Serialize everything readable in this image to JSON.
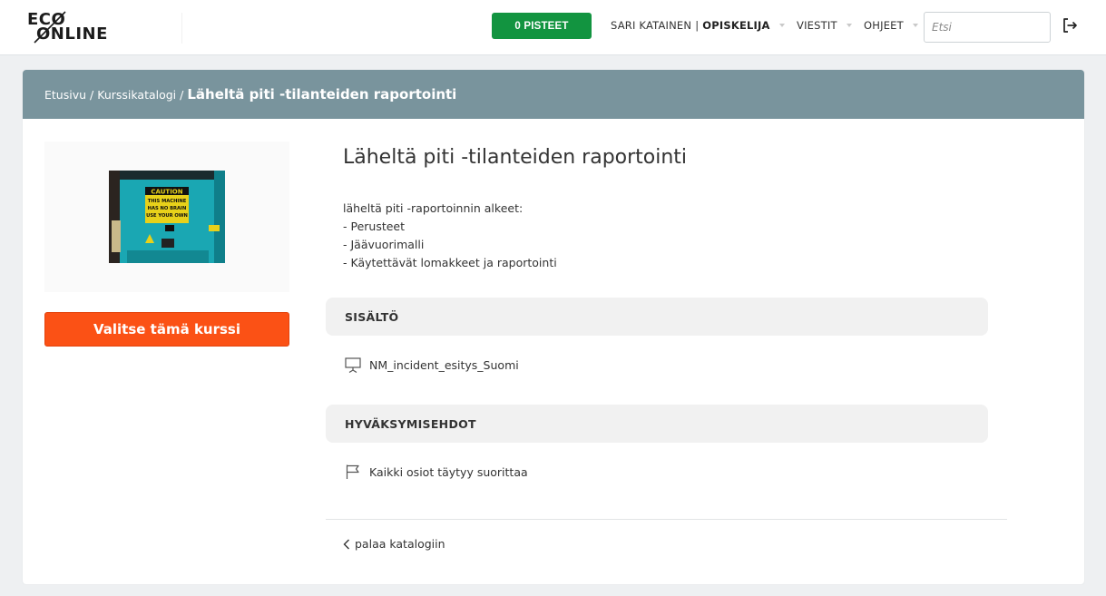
{
  "navbar": {
    "logo_top": "ECO",
    "logo_bottom": "ONLINE",
    "points_label": "0 PISTEET",
    "user_name": "SARI KATAINEN",
    "user_separator": "|",
    "user_role": "OPISKELIJA",
    "messages_label": "VIESTIT",
    "help_label": "OHJEET",
    "search_placeholder": "Etsi",
    "search_value": ""
  },
  "breadcrumb": {
    "home": "Etusivu",
    "catalog": "Kurssikatalogi",
    "separator": "/",
    "current": "Läheltä piti -tilanteiden raportointi"
  },
  "course": {
    "title": "Läheltä piti -tilanteiden raportointi",
    "description_lines": [
      "läheltä piti -raportoinnin alkeet:",
      "- Perusteet",
      "- Jäävuorimalli",
      "- Käytettävät lomakkeet ja raportointi"
    ],
    "image_text_lines": [
      "CAUTION",
      "THIS MACHINE",
      "HAS NO BRAIN",
      "USE YOUR OWN"
    ],
    "select_button": "Valitse tämä kurssi"
  },
  "content_section": {
    "heading": "SISÄLTÖ",
    "items": [
      {
        "icon": "presentation-icon",
        "label": "NM_incident_esitys_Suomi"
      }
    ]
  },
  "criteria_section": {
    "heading": "HYVÄKSYMISEHDOT",
    "items": [
      {
        "icon": "flag-icon",
        "label": "Kaikki osiot täytyy suorittaa"
      }
    ]
  },
  "back_link": "palaa katalogiin",
  "colors": {
    "header_bar": "#79949d",
    "points_green": "#129440",
    "select_orange": "#fb5115",
    "page_bg": "#eef0f2"
  }
}
